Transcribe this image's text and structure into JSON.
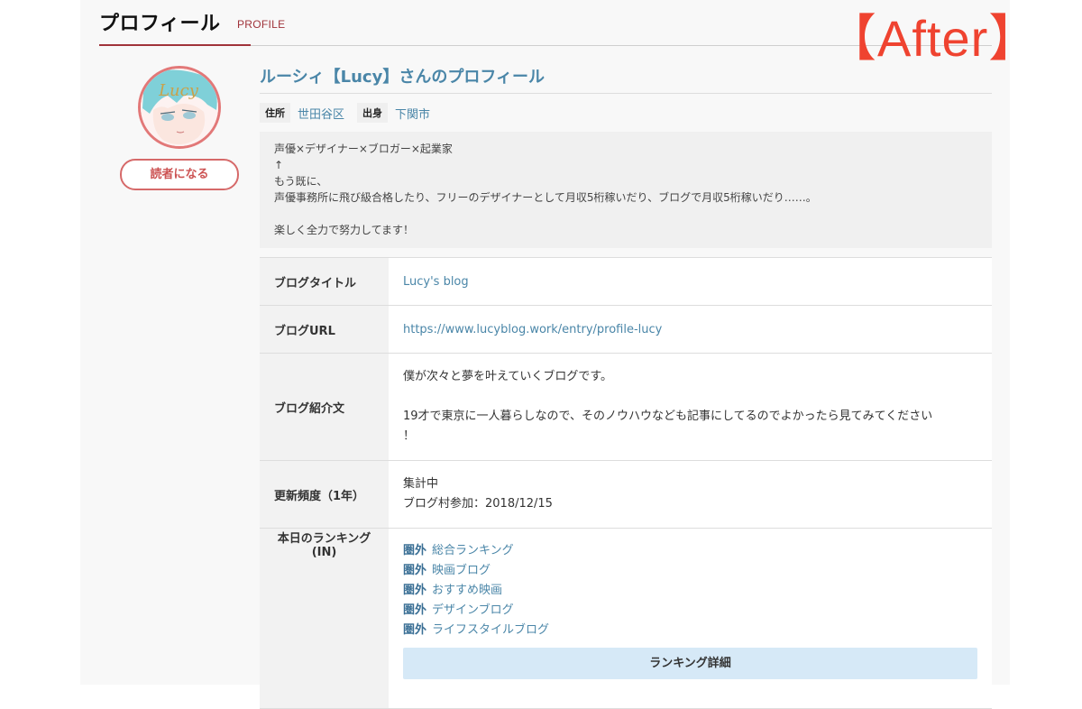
{
  "header": {
    "title": "プロフィール",
    "subtitle": "PROFILE",
    "stamp": "【After】"
  },
  "user": {
    "avatar_text": "Lucy",
    "follow_label": "読者になる",
    "profile_title": "ルーシィ【Lucy】さんのプロフィール",
    "meta": [
      {
        "label": "住所",
        "value": "世田谷区"
      },
      {
        "label": "出身",
        "value": "下関市"
      }
    ],
    "bio": [
      "声優×デザイナー×ブロガー×起業家",
      "↑",
      "もう既に、",
      "声優事務所に飛び級合格したり、フリーのデザイナーとして月収5桁稼いだり、ブログで月収5桁稼いだり……。",
      "",
      "楽しく全力で努力してます！"
    ]
  },
  "table": {
    "blog_title": {
      "label": "ブログタイトル",
      "value": "Lucy's blog"
    },
    "blog_url": {
      "label": "ブログURL",
      "value": "https://www.lucyblog.work/entry/profile-lucy"
    },
    "intro": {
      "label": "ブログ紹介文",
      "lines": [
        "僕が次々と夢を叶えていくブログです。",
        "",
        "19才で東京に一人暮らしなので、そのノウハウなども記事にしてるのでよかったら見てみてください",
        "！"
      ]
    },
    "frequency": {
      "label": "更新頻度（1年）",
      "lines": [
        "集計中",
        "ブログ村参加：2018/12/15"
      ]
    },
    "ranking": {
      "label_line1": "本日のランキング",
      "label_line2": "(IN)",
      "items": [
        {
          "rank": "圏外",
          "category": "総合ランキング"
        },
        {
          "rank": "圏外",
          "category": "映画ブログ"
        },
        {
          "rank": "圏外",
          "category": "おすすめ映画"
        },
        {
          "rank": "圏外",
          "category": "デザインブログ"
        },
        {
          "rank": "圏外",
          "category": "ライフスタイルブログ"
        }
      ],
      "detail_button": "ランキング詳細"
    }
  },
  "colors": {
    "accent_red": "#a0333a",
    "link_blue": "#4a86a8",
    "stamp_red": "#ef4330",
    "button_blue": "#d6e9f7"
  }
}
